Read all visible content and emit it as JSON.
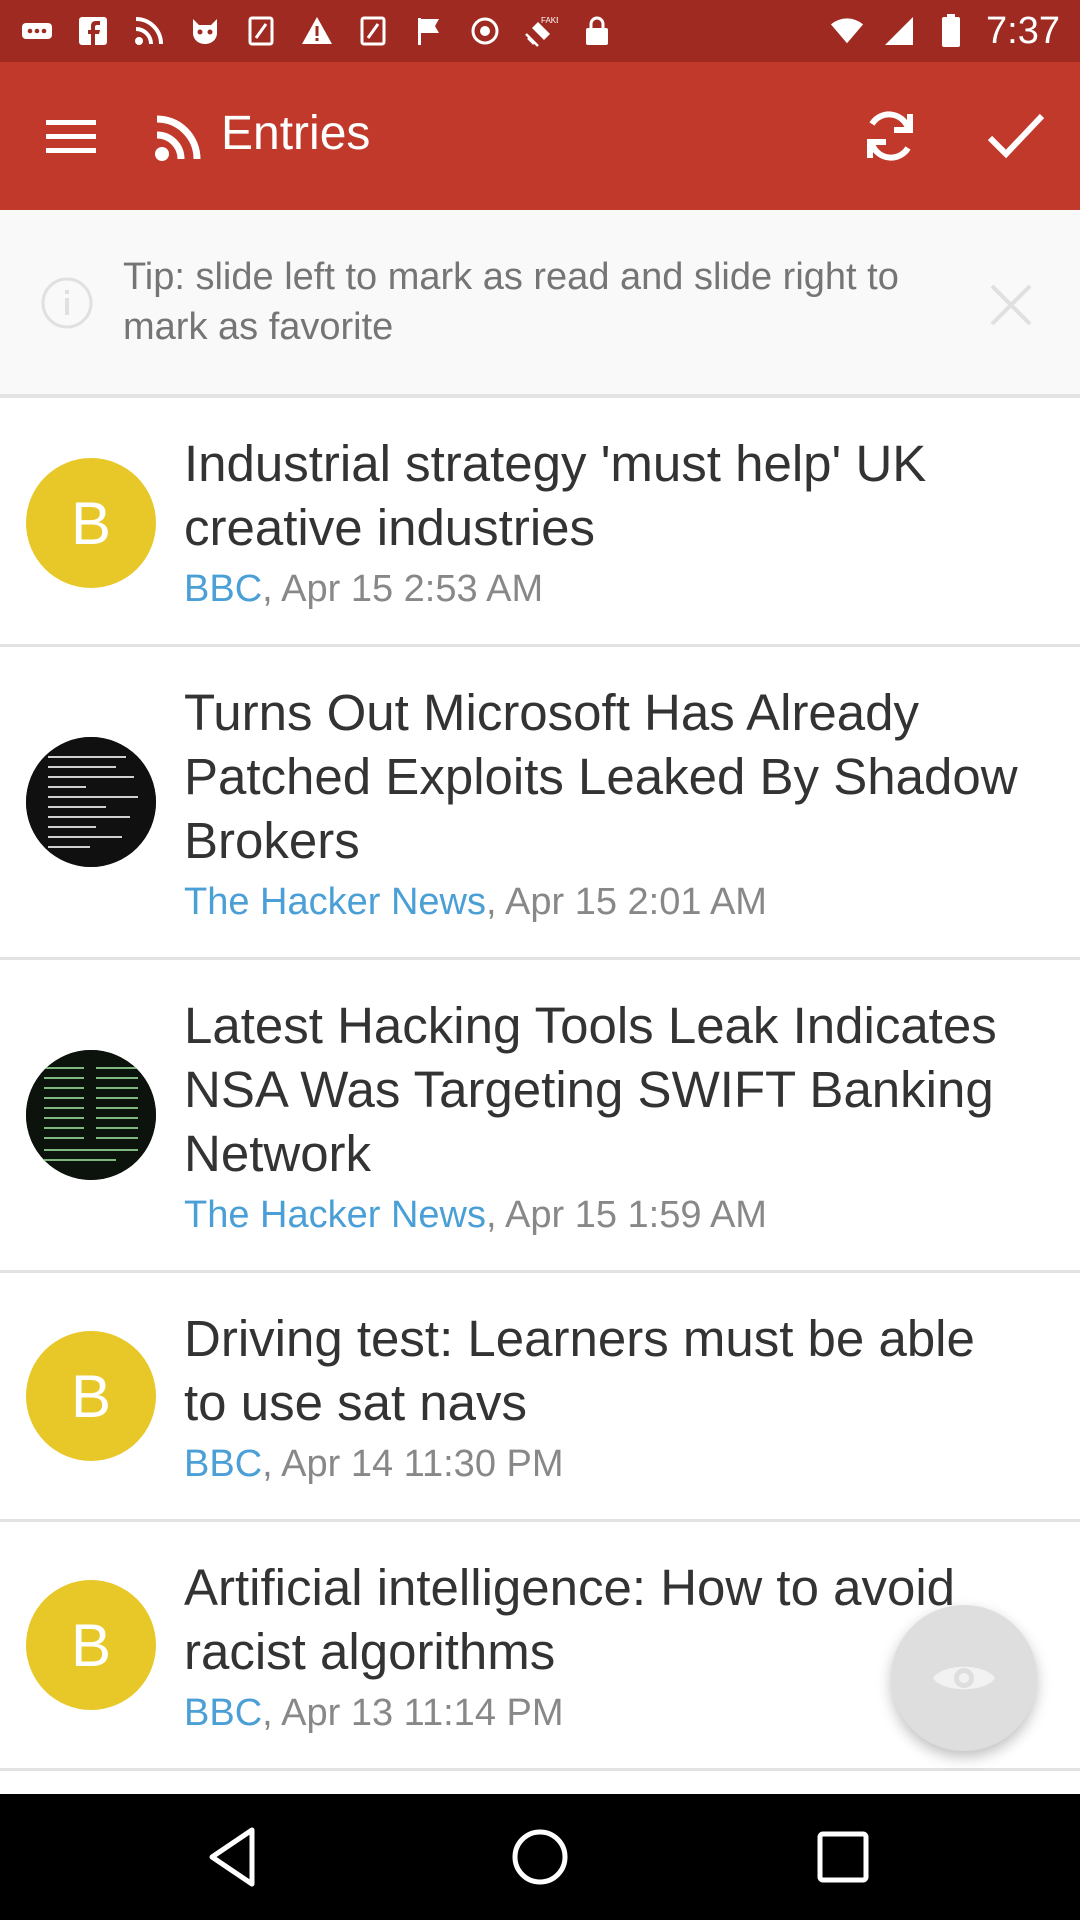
{
  "status_bar": {
    "time": "7:37",
    "left_icons": [
      "more-icon",
      "facebook-icon",
      "rss-icon",
      "cat-icon",
      "app-icon",
      "warning-icon",
      "app-icon",
      "flag-icon",
      "sync-icon",
      "fake-gps-icon",
      "lock-icon"
    ]
  },
  "app_bar": {
    "title": "Entries",
    "menu_icon": "menu-icon",
    "feed_icon": "rss-icon",
    "refresh_icon": "refresh-icon",
    "mark_read_icon": "check-icon"
  },
  "tip": {
    "text": "Tip: slide left to mark as read and slide right to mark as favorite"
  },
  "entries": [
    {
      "avatar": "B",
      "avatar_type": "letter",
      "title": "Industrial strategy 'must help' UK creative industries",
      "source": "BBC",
      "date": ", Apr 15 2:53 AM"
    },
    {
      "avatar": "",
      "avatar_type": "image",
      "title": "Turns Out Microsoft Has Already Patched Exploits Leaked By Shadow Brokers",
      "source": "The Hacker News",
      "date": ", Apr 15 2:01 AM"
    },
    {
      "avatar": "",
      "avatar_type": "image",
      "title": "Latest Hacking Tools Leak Indicates NSA Was Targeting SWIFT Banking Network",
      "source": "The Hacker News",
      "date": ", Apr 15 1:59 AM"
    },
    {
      "avatar": "B",
      "avatar_type": "letter",
      "title": "Driving test: Learners must be able to use sat navs",
      "source": "BBC",
      "date": ", Apr 14 11:30 PM"
    },
    {
      "avatar": "B",
      "avatar_type": "letter",
      "title": "Artificial intelligence: How to avoid racist algorithms",
      "source": "BBC",
      "date": ", Apr 13 11:14 PM"
    }
  ],
  "colors": {
    "app_bar": "#c0392b",
    "status_bar": "#9e2a22",
    "avatar": "#e8c829",
    "source_link": "#4a9fd6"
  }
}
